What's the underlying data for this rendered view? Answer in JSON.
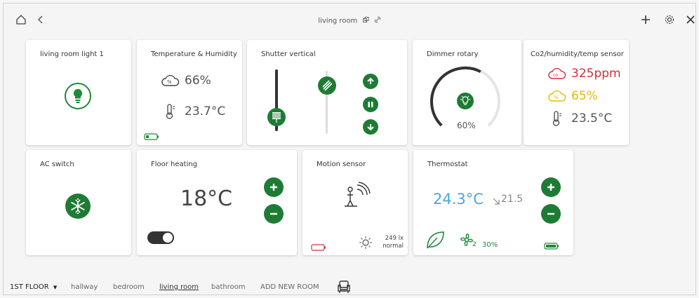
{
  "header": {
    "title": "living room",
    "home_icon": "home-icon",
    "back_icon": "chevron-left-icon",
    "add_icon": "plus-icon",
    "settings_icon": "gear-icon",
    "close_icon": "close-icon"
  },
  "cards": {
    "light": {
      "title": "living room light 1"
    },
    "temp_humidity": {
      "title": "Temperature & Humidity",
      "humidity": "66%",
      "temperature": "23.7°C"
    },
    "shutter": {
      "title": "Shutter vertical"
    },
    "dimmer": {
      "title": "Dimmer rotary",
      "level_label": "60%",
      "level": 0.6
    },
    "co2": {
      "title": "Co2/humidity/temp sensor",
      "co2": "325ppm",
      "humidity": "65%",
      "temperature": "23.5°C"
    },
    "ac": {
      "title": "AC switch"
    },
    "floor_heating": {
      "title": "Floor heating",
      "setpoint": "18°C"
    },
    "motion": {
      "title": "Motion sensor",
      "lux": "249 lx",
      "lux_status": "normal"
    },
    "thermostat": {
      "title": "Thermostat",
      "current": "24.3°C",
      "target": "21.5",
      "fan_speed": "2",
      "fan_percent": "30%"
    }
  },
  "bottom_nav": {
    "floor": "1ST FLOOR",
    "rooms": [
      "hallway",
      "bedroom",
      "living room",
      "bathroom"
    ],
    "add_room": "ADD NEW ROOM"
  },
  "colors": {
    "accent_green": "#1e7b34",
    "co2_red": "#d0303a",
    "humidity_yellow": "#e8b800",
    "temp_blue": "#4aa8d8"
  }
}
